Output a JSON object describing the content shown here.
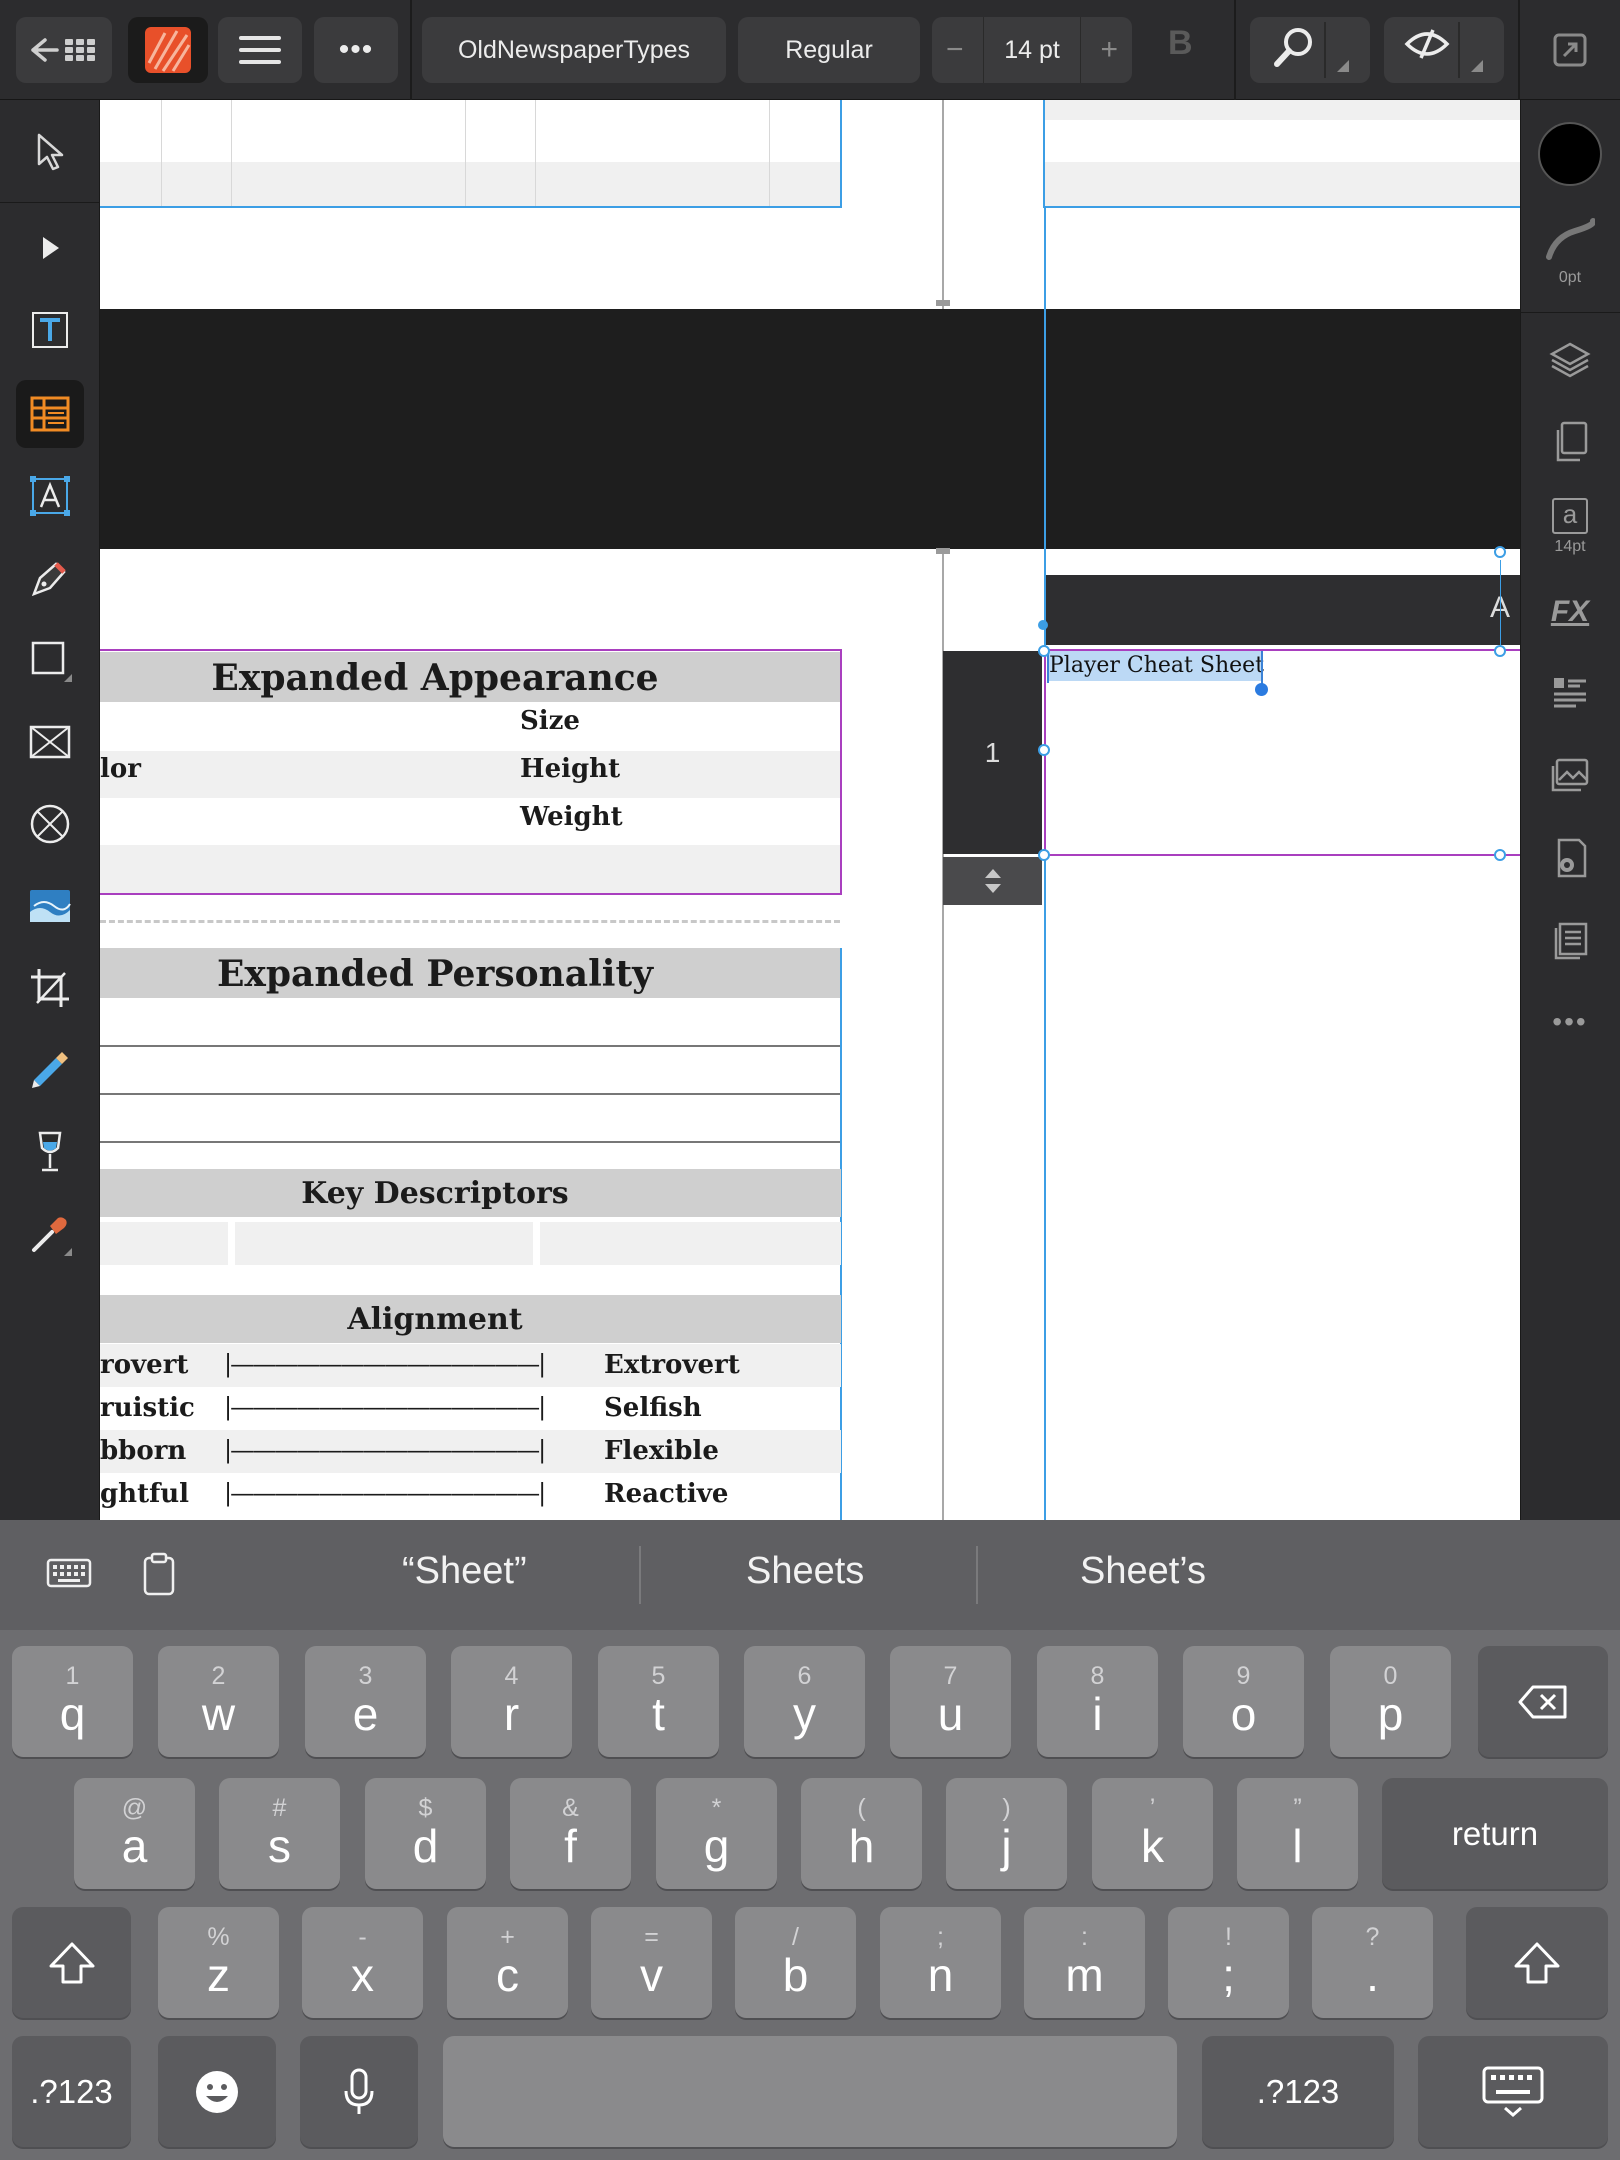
{
  "toolbar": {
    "font_name": "OldNewspaperTypes",
    "font_style": "Regular",
    "font_size": "14 pt",
    "bold_label": "B",
    "minus": "−",
    "plus": "+",
    "more": "•••"
  },
  "right_panel": {
    "stroke_label": "0pt",
    "text_style_glyph": "a",
    "text_style_label": "14pt",
    "fx_label": "FX",
    "more": "•••"
  },
  "document": {
    "sections": {
      "appearance_title": "Expanded Appearance",
      "appearance_rows": [
        {
          "left": "lor",
          "right": "Size"
        },
        {
          "left": "",
          "right": "Height"
        },
        {
          "left": "",
          "right": "Weight"
        }
      ],
      "personality_title": "Expanded Personality",
      "descriptors_title": "Key Descriptors",
      "alignment_title": "Alignment",
      "alignment_rows": [
        {
          "left": "rovert",
          "scale": "|——————————————|",
          "right": "Extrovert"
        },
        {
          "left": "ruistic",
          "scale": "|——————————————|",
          "right": "Selfish"
        },
        {
          "left": "bborn",
          "scale": "|——————————————|",
          "right": "Flexible"
        },
        {
          "left": "ghtful",
          "scale": "|——————————————|",
          "right": "Reactive"
        }
      ]
    },
    "text_frame": "Player Cheat Sheet",
    "page_number": "1",
    "text_tab_glyph": "A"
  },
  "keyboard": {
    "predictions": [
      "“Sheet”",
      "Sheets",
      "Sheet’s"
    ],
    "row1": [
      {
        "k": "q",
        "h": "1"
      },
      {
        "k": "w",
        "h": "2"
      },
      {
        "k": "e",
        "h": "3"
      },
      {
        "k": "r",
        "h": "4"
      },
      {
        "k": "t",
        "h": "5"
      },
      {
        "k": "y",
        "h": "6"
      },
      {
        "k": "u",
        "h": "7"
      },
      {
        "k": "i",
        "h": "8"
      },
      {
        "k": "o",
        "h": "9"
      },
      {
        "k": "p",
        "h": "0"
      }
    ],
    "row2": [
      {
        "k": "a",
        "h": "@"
      },
      {
        "k": "s",
        "h": "#"
      },
      {
        "k": "d",
        "h": "$"
      },
      {
        "k": "f",
        "h": "&"
      },
      {
        "k": "g",
        "h": "*"
      },
      {
        "k": "h",
        "h": "("
      },
      {
        "k": "j",
        "h": ")"
      },
      {
        "k": "k",
        "h": "’"
      },
      {
        "k": "l",
        "h": "”"
      }
    ],
    "row3": [
      {
        "k": "z",
        "h": "%"
      },
      {
        "k": "x",
        "h": "-"
      },
      {
        "k": "c",
        "h": "+"
      },
      {
        "k": "v",
        "h": "="
      },
      {
        "k": "b",
        "h": "/"
      },
      {
        "k": "n",
        "h": ";"
      },
      {
        "k": "m",
        "h": ":"
      },
      {
        "k": ";",
        "h": "!"
      },
      {
        "k": ".",
        "h": "?"
      }
    ],
    "return_label": "return",
    "numbers_label": ".?123"
  }
}
